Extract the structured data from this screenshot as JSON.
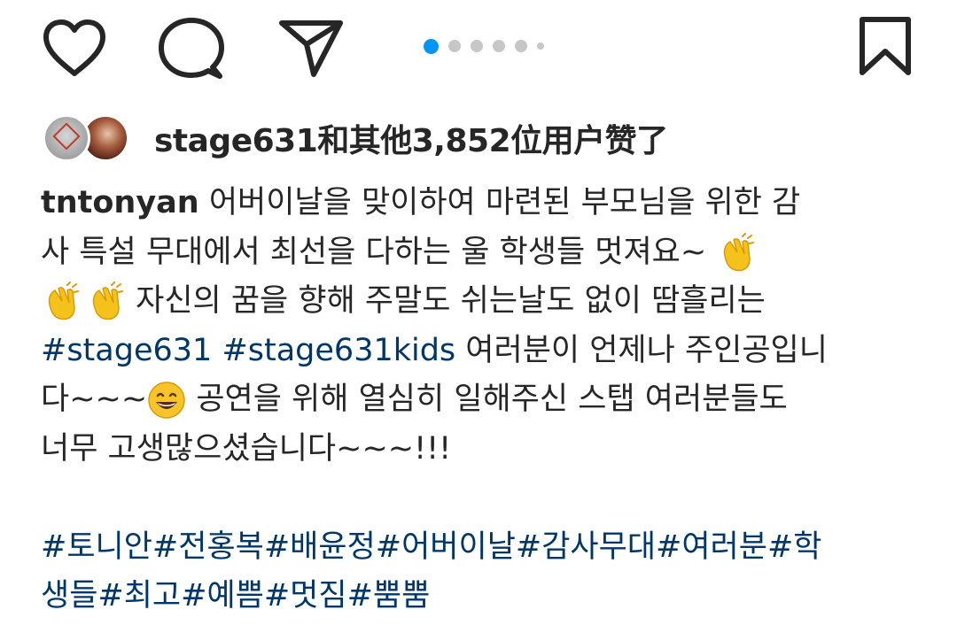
{
  "actions": {
    "like_icon": "heart-icon",
    "comment_icon": "comment-icon",
    "share_icon": "paper-plane-icon",
    "save_icon": "bookmark-icon"
  },
  "carousel": {
    "total_dots": 6,
    "active_index": 0,
    "accent": "#0095f6",
    "inactive": "#c7c7c7"
  },
  "likes": {
    "text": "stage631和其他3,852位用户赞了"
  },
  "caption": {
    "username": "tntonyan",
    "line1_text": " 어버이날을 맞이하여 마련된 부모님을 위한 감",
    "line2_text": "사 특설 무대에서 최선을 다하는 울 학생들 멋져요~ ",
    "line3_text": " 자신의 꿈을 향해 주말도 쉬는날도 없이 땀흘리는",
    "line4_tag1": "#stage631",
    "line4_tag2": "#stage631kids",
    "line4_text": " 여러분이 언제나 주인공입니",
    "line5_text_a": "다~~~",
    "line5_text_b": " 공연을 위해 열심히 일해주신 스탭 여러분들도",
    "line6_text": "너무 고생많으셨습니다~~~!!!",
    "tags_line1": "#토니안#전홍복#배윤정#어버이날#감사무대#여러분#학",
    "tags_line2": "생들#최고#예쁨#멋짐#뿜뿜",
    "emojis": [
      "clapping-hands",
      "clapping-hands",
      "clapping-hands",
      "grinning-face"
    ]
  },
  "colors": {
    "text": "#262626",
    "hashtag": "#00376b"
  }
}
